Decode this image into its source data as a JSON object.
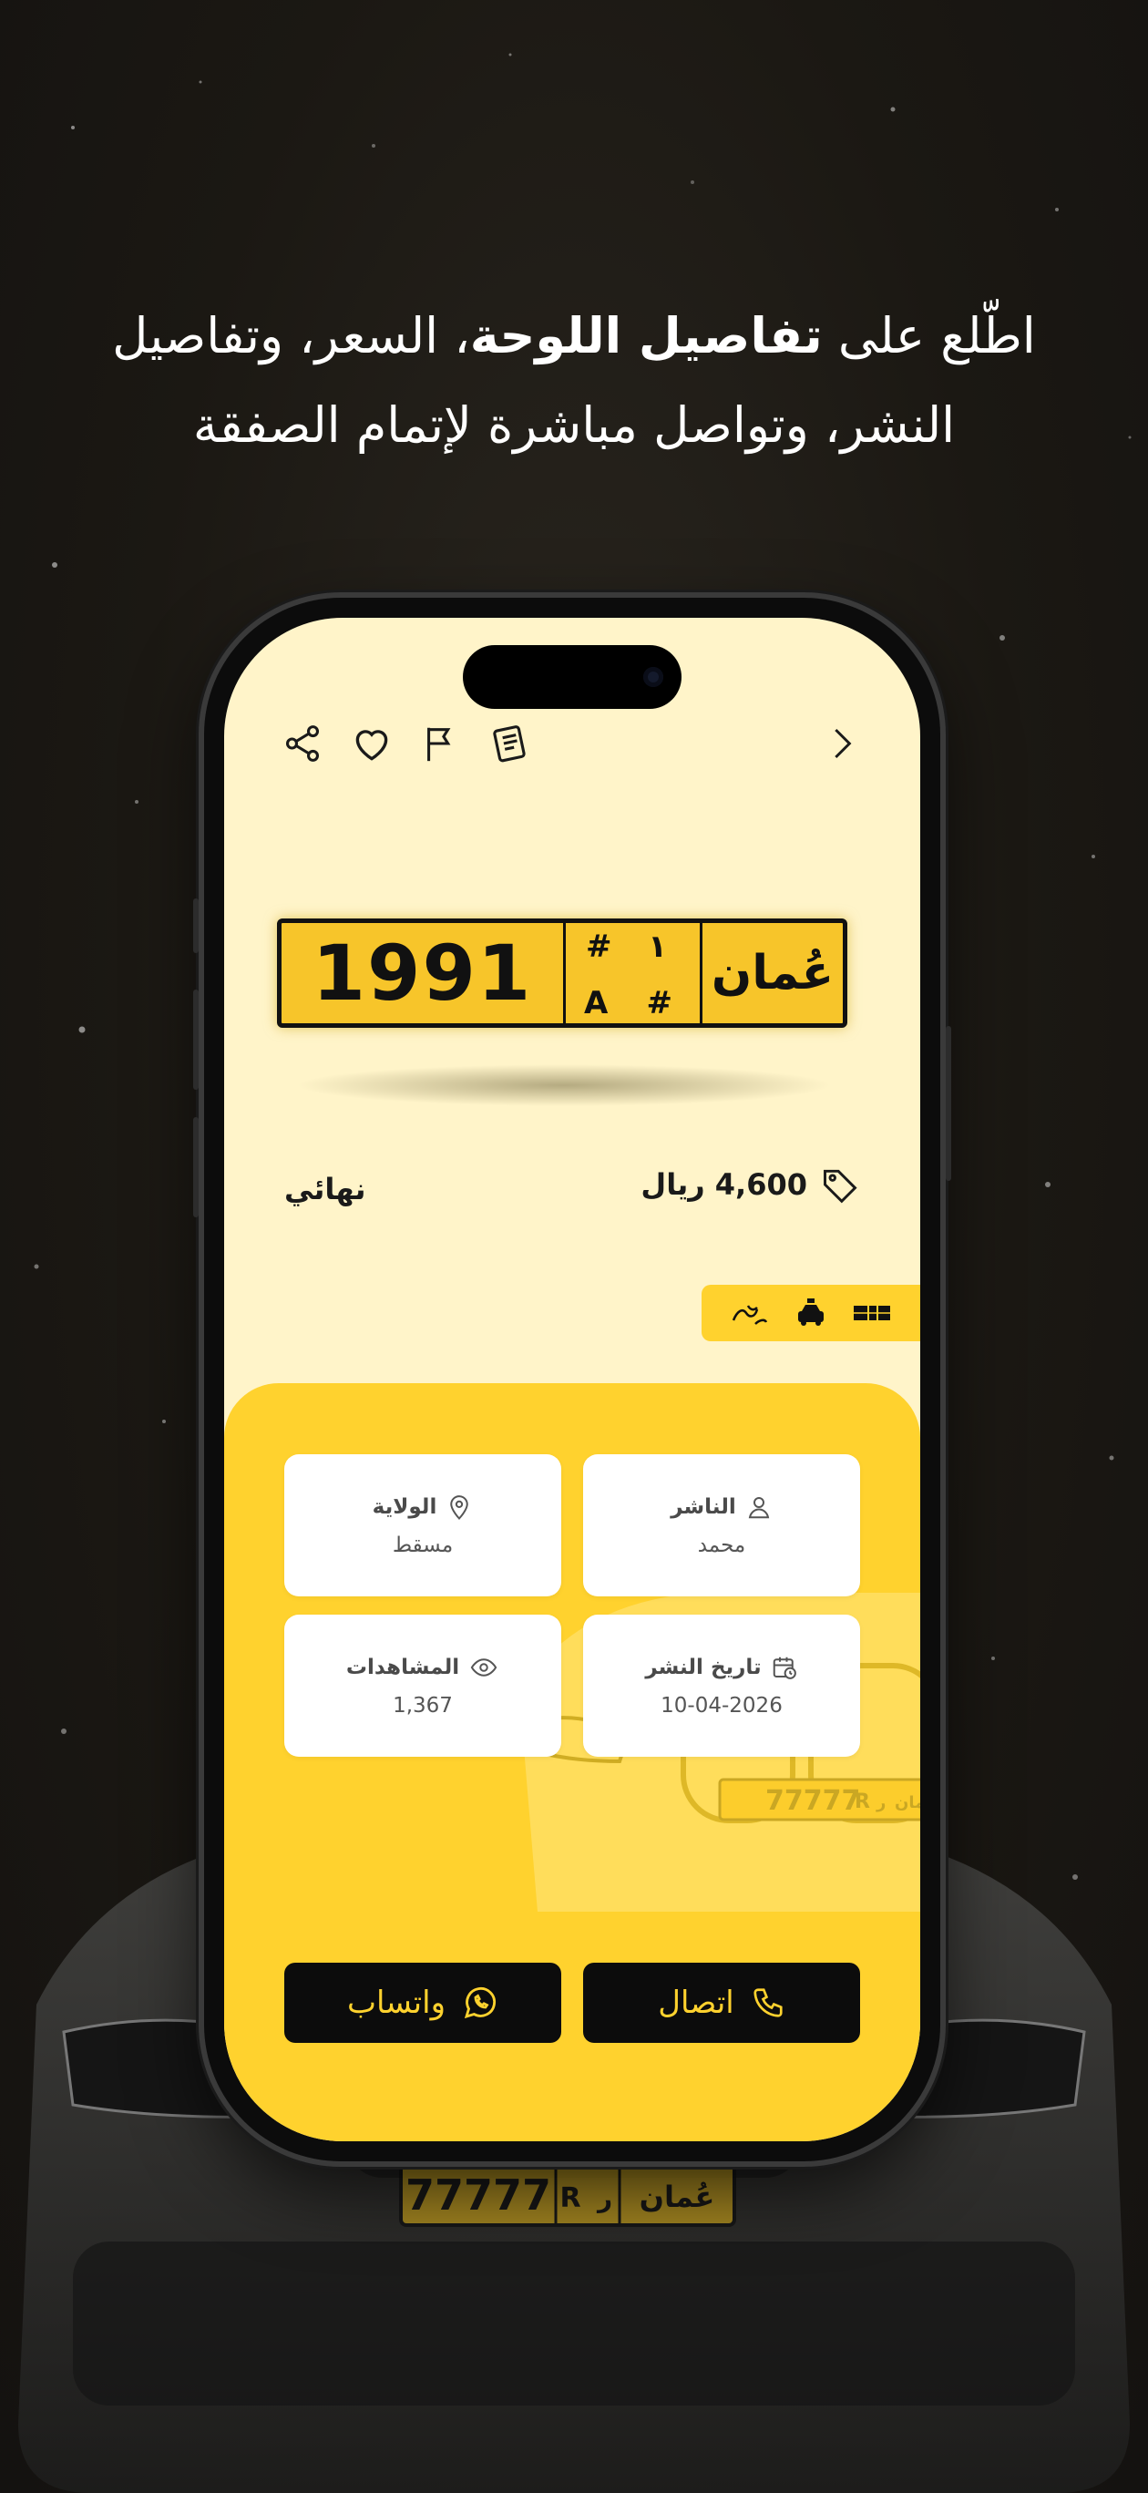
{
  "headline": {
    "line1_pre": "اطّلع على ",
    "line1_bold": "تفاصيل اللوحة",
    "line1_post": "، السعر، وتفاصيل",
    "line2": "النشر، وتواصل مباشرة لإتمام الصفقة"
  },
  "topbar": {
    "icons": [
      "share-icon",
      "heart-icon",
      "flag-icon",
      "notes-icon"
    ],
    "back_icon": "chevron-right-icon"
  },
  "plate": {
    "number": "1991",
    "code_top_left": "#",
    "code_top_right": "١",
    "code_bottom_left": "A",
    "code_bottom_right": "#",
    "country": "عُمان"
  },
  "listing": {
    "price": "4,600 ريال",
    "status": "نهائي"
  },
  "tags": [
    "plate-tag-icon",
    "car-tag-icon",
    "calligraphy-tag-icon"
  ],
  "details": {
    "publisher_label": "الناشر",
    "publisher_value": "محمد",
    "state_label": "الولاية",
    "state_value": "مسقط",
    "date_label": "تاريخ النشر",
    "date_value": "10-04-2026",
    "views_label": "المشاهدات",
    "views_value": "1,367"
  },
  "actions": {
    "call": "اتصال",
    "whatsapp": "واتساب"
  },
  "bg_plate": {
    "number": "77777",
    "letter": "R",
    "letter_ar": "ر",
    "country": "عُمان"
  },
  "colors": {
    "accent_yellow": "#ffd22e",
    "screen_cream": "#fff4c9",
    "dark": "#0c0c0c"
  }
}
